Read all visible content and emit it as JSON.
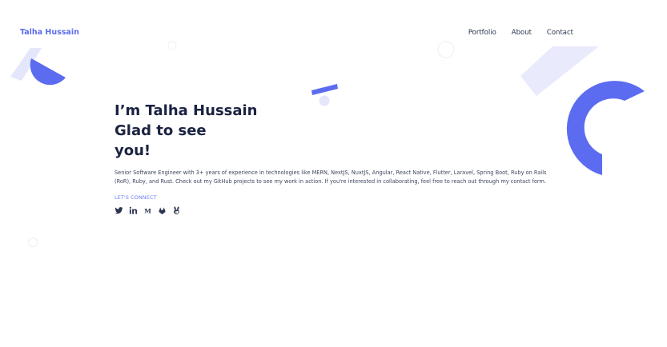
{
  "nav": {
    "brand": "Talha Hussain",
    "links": [
      {
        "label": "Portfolio"
      },
      {
        "label": "About"
      },
      {
        "label": "Contact"
      }
    ]
  },
  "hero": {
    "title_lines": [
      "I’m Talha Hussain",
      "Glad to see",
      "you!"
    ],
    "description": "Senior Software Engineer with 3+ years of experience in technologies like MERN, NextJS, NuxtJS, Angular, React Native, Flutter, Laravel, Spring Boot, Ruby on Rails (RoR), Ruby, and Rust. Check out my GitHub projects to see my work in action. If you're interested in collaborating, feel free to reach out through my contact form.",
    "cta": "LET'S CONNECT"
  },
  "socials": [
    {
      "icon": "twitter-icon"
    },
    {
      "icon": "linkedin-icon"
    },
    {
      "icon": "medium-icon"
    },
    {
      "icon": "gitlab-icon"
    },
    {
      "icon": "angellist-icon"
    }
  ],
  "colors": {
    "accent": "#5b6cf0",
    "accent_light": "#e4e6fb",
    "heading": "#1a2340",
    "text": "#3f4660"
  }
}
